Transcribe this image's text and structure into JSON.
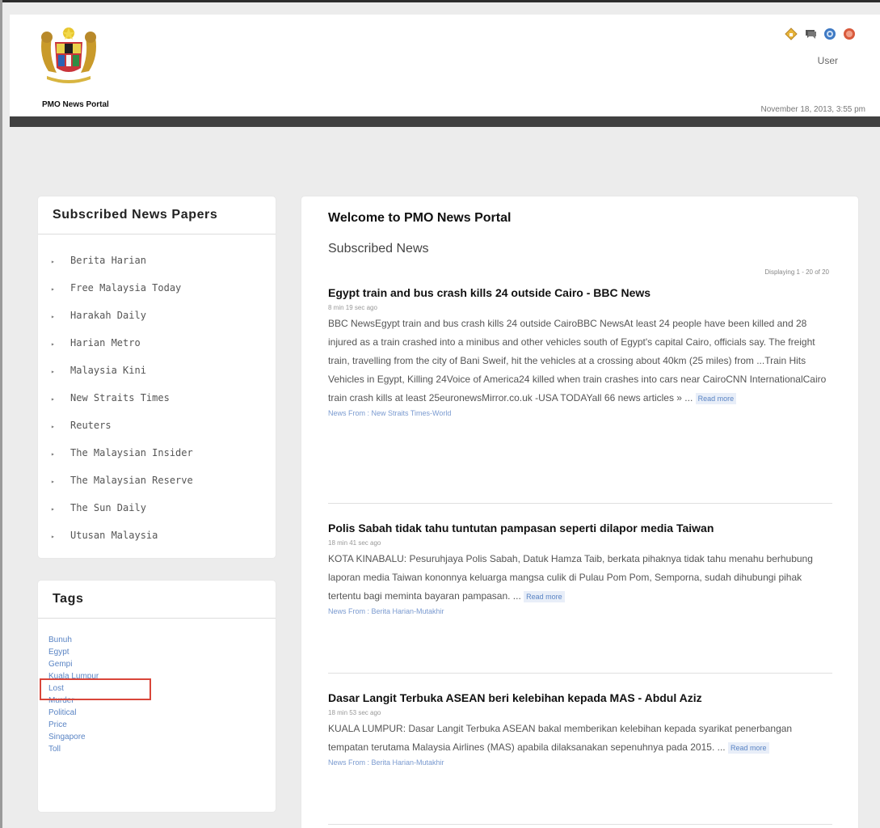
{
  "header": {
    "site_name": "PMO News Portal",
    "user_label": "User",
    "date": "November 18, 2013, 3:55 pm",
    "icons": [
      "home-icon",
      "chat-icon",
      "help-icon",
      "logout-icon"
    ],
    "bar_color": "#404040"
  },
  "sidebar": {
    "papers_title": "Subscribed News Papers",
    "papers": [
      "Berita Harian",
      "Free Malaysia Today",
      "Harakah Daily",
      "Harian Metro",
      "Malaysia Kini",
      "New Straits Times",
      "Reuters",
      "The Malaysian Insider",
      "The Malaysian Reserve",
      "The Sun Daily",
      "Utusan Malaysia"
    ],
    "tags_title": "Tags",
    "tags": [
      "Bunuh",
      "Egypt",
      "Gempi",
      "Kuala Lumpur",
      "Lost",
      "Murder",
      "Political",
      "Price",
      "Singapore",
      "Toll"
    ],
    "highlighted_tag": "Kuala Lumpur",
    "highlight_color": "#d9463a"
  },
  "main": {
    "welcome": "Welcome to PMO News Portal",
    "subtitle": "Subscribed News",
    "displaying": "Displaying 1 - 20 of 20",
    "articles": [
      {
        "title": "Egypt train and bus crash kills 24 outside Cairo - BBC News",
        "time": "8 min 19 sec ago",
        "body": "BBC NewsEgypt train and bus crash kills 24 outside CairoBBC NewsAt least 24 people have been killed and 28 injured as a train crashed into a minibus and other vehicles south of Egypt's capital Cairo, officials say. The freight train, travelling from the city of Bani Sweif, hit the vehicles at a crossing about 40km (25 miles) from ...Train Hits Vehicles in Egypt, Killing 24Voice of America24 killed when train crashes into cars near CairoCNN InternationalCairo train crash kills at least 25euronewsMirror.co.uk -USA TODAYall 66 news articles » ...",
        "read_more": "Read more",
        "source": "News From : New Straits Times-World"
      },
      {
        "title": "Polis Sabah tidak tahu tuntutan pampasan seperti dilapor media Taiwan",
        "time": "18 min 41 sec ago",
        "body": "KOTA KINABALU: Pesuruhjaya Polis Sabah, Datuk Hamza Taib, berkata pihaknya tidak tahu menahu berhubung laporan media Taiwan kononnya keluarga mangsa culik di Pulau Pom Pom, Semporna, sudah dihubungi pihak tertentu bagi meminta bayaran pampasan. ...",
        "read_more": "Read more",
        "source": "News From : Berita Harian-Mutakhir"
      },
      {
        "title": "Dasar Langit Terbuka ASEAN beri kelebihan kepada MAS - Abdul Aziz",
        "time": "18 min 53 sec ago",
        "body": "KUALA LUMPUR: Dasar Langit Terbuka ASEAN bakal memberikan kelebihan kepada syarikat penerbangan tempatan terutama Malaysia Airlines (MAS) apabila dilaksanakan sepenuhnya pada 2015. ...",
        "read_more": "Read more",
        "source": "News From : Berita Harian-Mutakhir"
      }
    ]
  }
}
